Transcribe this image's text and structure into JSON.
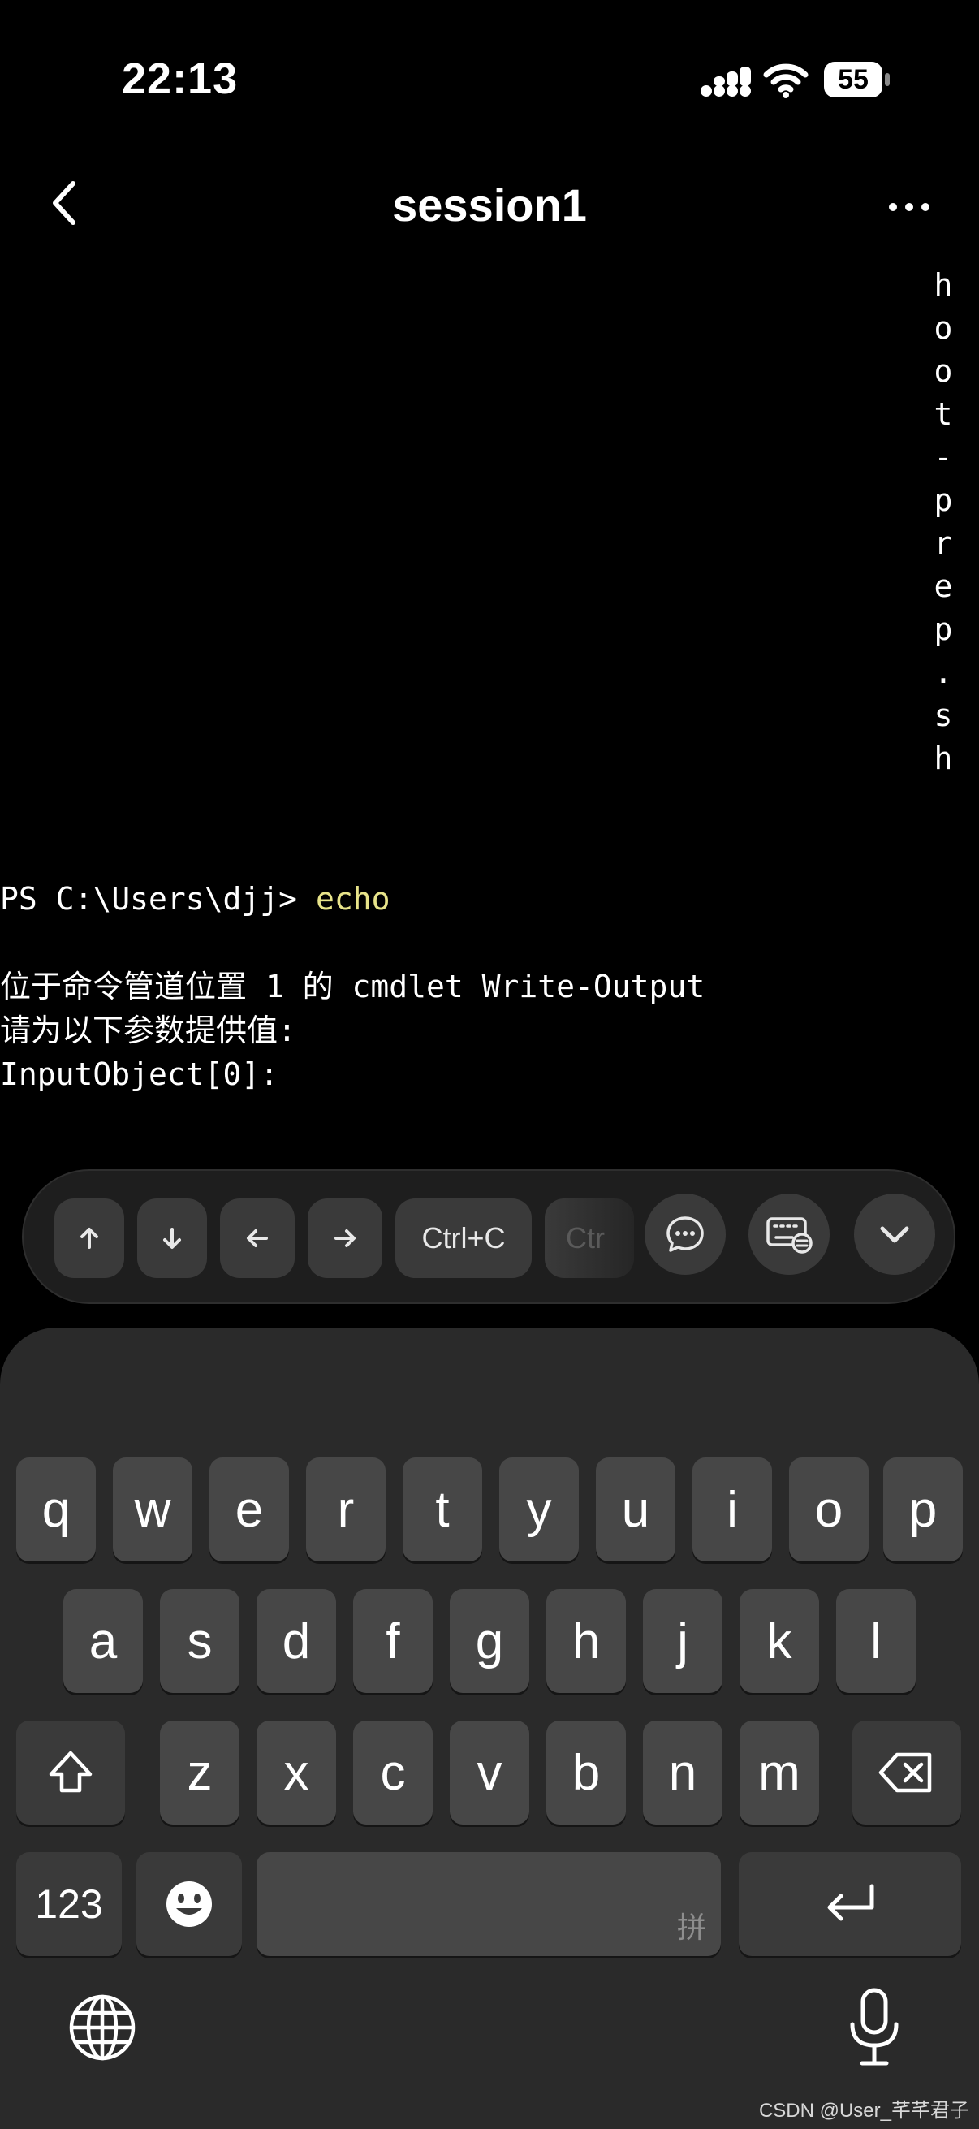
{
  "status_bar": {
    "time": "22:13",
    "battery": "55"
  },
  "nav": {
    "title": "session1"
  },
  "side_filename": [
    "h",
    "o",
    "o",
    "t",
    "-",
    "p",
    "r",
    "e",
    "p",
    ".",
    "s",
    "h"
  ],
  "terminal": {
    "prompt": "PS C:\\Users\\djj> ",
    "command": "echo",
    "lines": [
      "位于命令管道位置 1 的 cmdlet Write-Output",
      "请为以下参数提供值:",
      "InputObject[0]:"
    ]
  },
  "toolbar": {
    "ctrl_c_label": "Ctrl+C",
    "partial_label": "Ctr"
  },
  "keyboard": {
    "row1": [
      "q",
      "w",
      "e",
      "r",
      "t",
      "y",
      "u",
      "i",
      "o",
      "p"
    ],
    "row2": [
      "a",
      "s",
      "d",
      "f",
      "g",
      "h",
      "j",
      "k",
      "l"
    ],
    "row3": [
      "z",
      "x",
      "c",
      "v",
      "b",
      "n",
      "m"
    ],
    "numbers_label": "123",
    "space_hint": "拼"
  },
  "watermark": "CSDN @User_芊芊君子"
}
